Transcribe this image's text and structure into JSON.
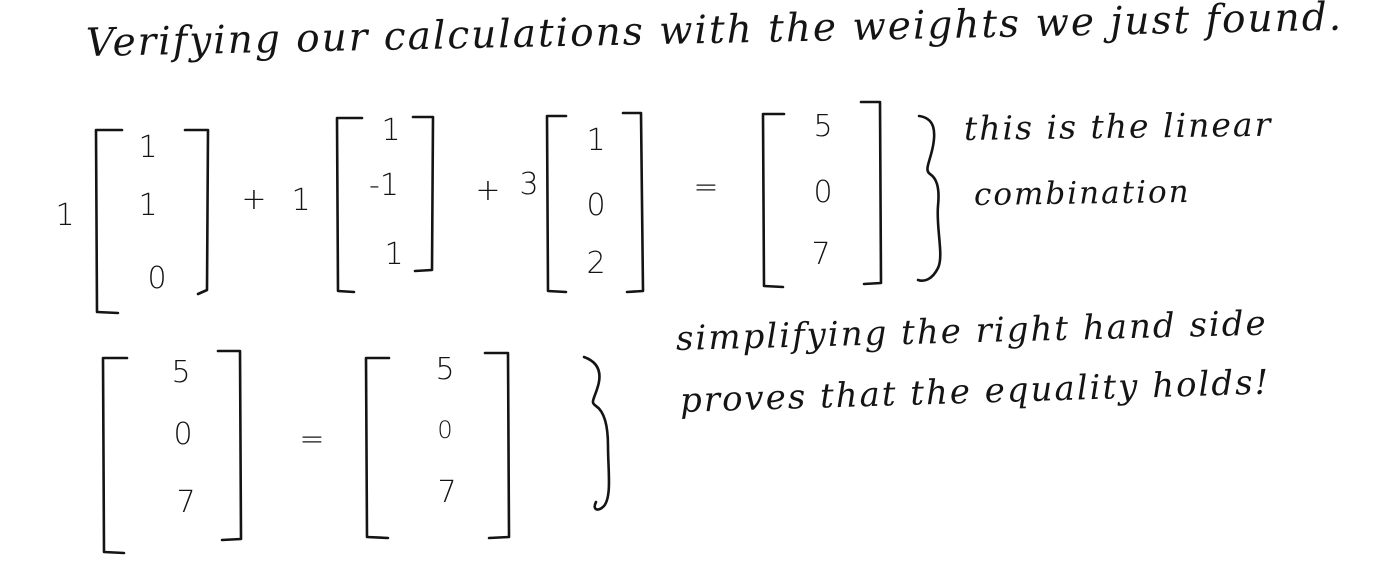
{
  "heading": "Verifying our calculations with the weights we just found.",
  "row1": {
    "coefficients": [
      "1",
      "1",
      "3"
    ],
    "plus_sign": "+",
    "equals_sign": "=",
    "vectors": [
      [
        "1",
        "1",
        "0"
      ],
      [
        "1",
        "-1",
        "1"
      ],
      [
        "1",
        "0",
        "2"
      ]
    ],
    "result": [
      "5",
      "0",
      "7"
    ],
    "note_line1": "this is the linear",
    "note_line2": "combination"
  },
  "row2": {
    "left": [
      "5",
      "0",
      "7"
    ],
    "equals_sign": "=",
    "right": [
      "5",
      "0",
      "7"
    ],
    "note_line1": "simplifying the right hand side",
    "note_line2": "proves that the equality holds!"
  }
}
